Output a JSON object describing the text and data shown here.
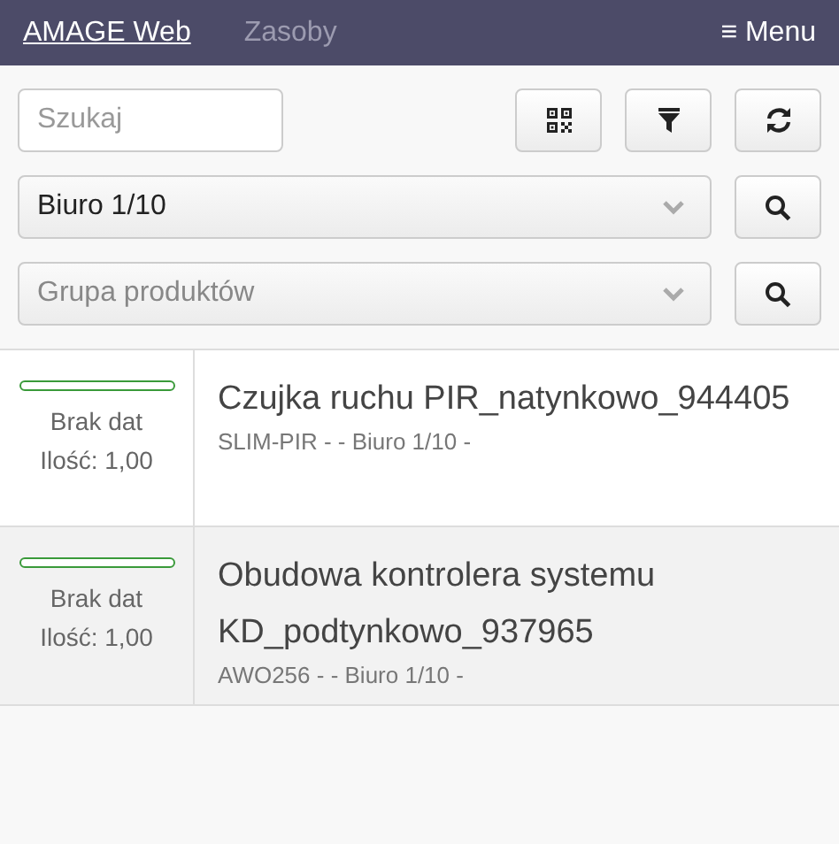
{
  "navbar": {
    "brand": "AMAGE Web",
    "link": "Zasoby",
    "menu_icon": "≡",
    "menu": "Menu"
  },
  "search": {
    "placeholder": "Szukaj"
  },
  "location_select": {
    "value": "Biuro 1/10"
  },
  "group_select": {
    "placeholder": "Grupa produktów"
  },
  "items": [
    {
      "status": "Brak dat",
      "quantity": "Ilość: 1,00",
      "name": "Czujka ruchu PIR_natynkowo_944405",
      "details": "SLIM-PIR - - Biuro 1/10 -"
    },
    {
      "status": "Brak dat",
      "quantity": "Ilość: 1,00",
      "name": "Obudowa kontrolera systemu KD_podtynkowo_937965",
      "details": "AWO256 - - Biuro 1/10 -"
    }
  ]
}
